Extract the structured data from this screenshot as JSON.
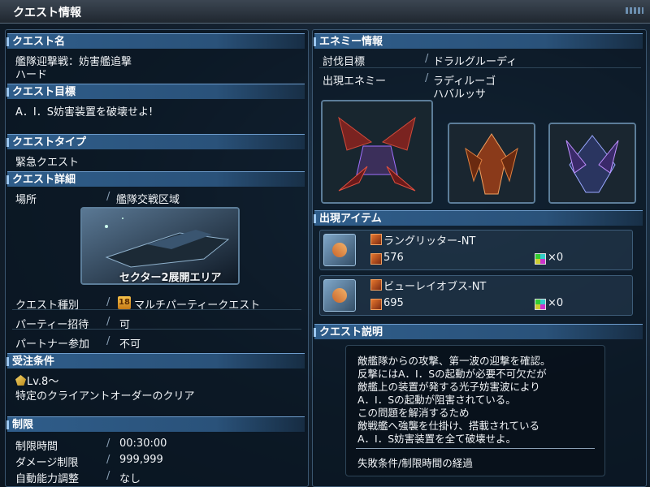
{
  "window": {
    "title": "クエスト情報"
  },
  "quest": {
    "name_header": "クエスト名",
    "name": "艦隊迎撃戦：妨害艦追撃",
    "difficulty": "ハード",
    "goal_header": "クエスト目標",
    "goal": "A．I．S妨害装置を破壊せよ!",
    "type_header": "クエストタイプ",
    "type": "緊急クエスト",
    "detail_header": "クエスト詳細",
    "location_label": "場所",
    "location": "艦隊交戦区域",
    "area_caption": "セクター2展開エリア",
    "kind_label": "クエスト種別",
    "kind": "マルチパーティークエスト",
    "party_invite_label": "パーティー招待",
    "party_invite": "可",
    "partner_label": "パートナー参加",
    "partner": "不可",
    "conditions_header": "受注条件",
    "level_req": "Lv.8～",
    "client_req": "特定のクライアントオーダーのクリア",
    "limits_header": "制限",
    "time_limit_label": "制限時間",
    "time_limit": "00:30:00",
    "damage_limit_label": "ダメージ制限",
    "damage_limit": "999,999",
    "auto_adjust_label": "自動能力調整",
    "auto_adjust": "なし"
  },
  "enemy": {
    "header": "エネミー情報",
    "target_label": "討伐目標",
    "target": "ドラルグルーディ",
    "appear_label": "出現エネミー",
    "appear": [
      "ラディルーゴ",
      "ハバルッサ"
    ]
  },
  "items": {
    "header": "出現アイテム",
    "list": [
      {
        "name": "ラングリッター-NT",
        "value": "576",
        "count": "×0"
      },
      {
        "name": "ビューレイオブス-NT",
        "value": "695",
        "count": "×0"
      }
    ]
  },
  "description": {
    "header": "クエスト説明",
    "lines": [
      "敵艦隊からの攻撃、第一波の迎撃を確認。",
      "反撃にはA．I．Sの起動が必要不可欠だが",
      "敵艦上の装置が発する光子妨害波により",
      "A．I．Sの起動が阻害されている。",
      "この問題を解消するため",
      "敵戦艦へ強襲を仕掛け、搭載されている",
      "A．I．S妨害装置を全て破壊せよ。"
    ],
    "failure": "失敗条件/制限時間の経過"
  },
  "icons": {
    "multi_party": "multi-party-quest-icon",
    "level": "level-requirement-icon",
    "weapon": "weapon-item-icon",
    "gem": "gem-count-icon"
  }
}
